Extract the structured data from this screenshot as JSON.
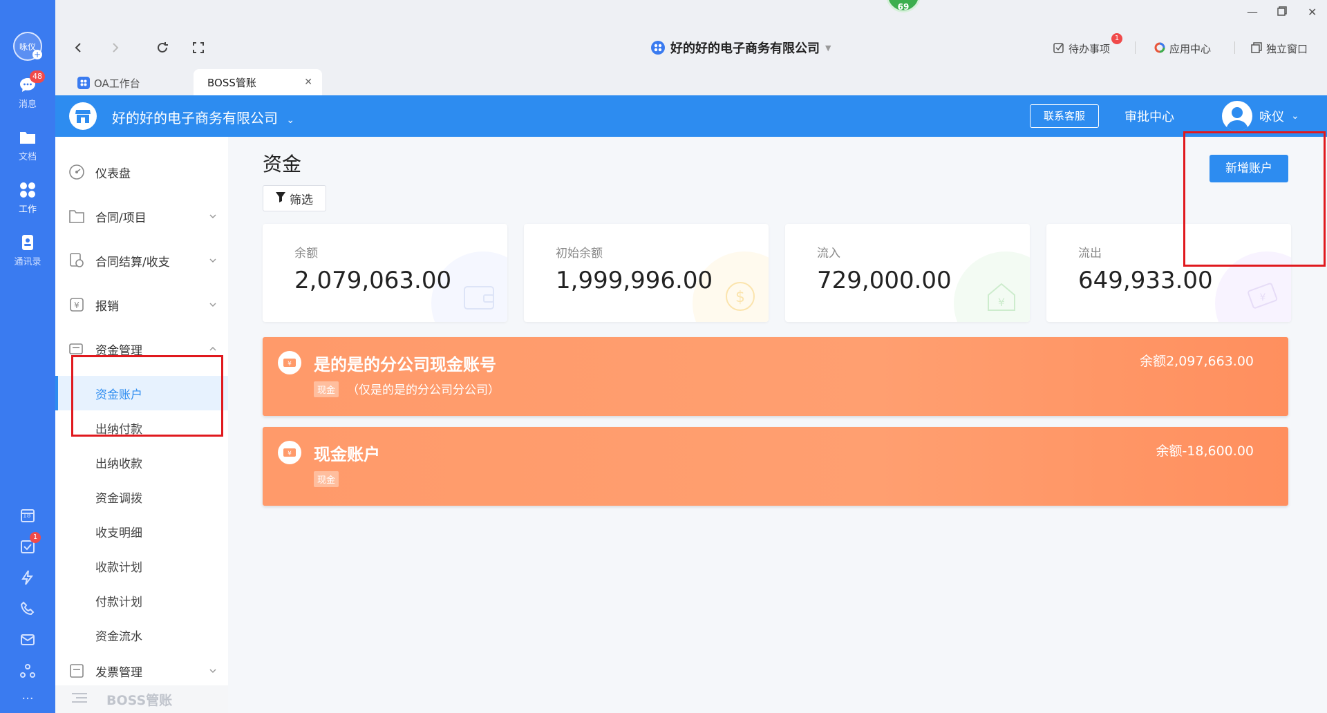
{
  "rail": {
    "avatar_text": "咏仪",
    "items": [
      {
        "label": "消息",
        "badge": "48"
      },
      {
        "label": "文档"
      },
      {
        "label": "工作"
      },
      {
        "label": "通讯录"
      }
    ],
    "calendar_day": "18",
    "tasks_badge": "1"
  },
  "topbar": {
    "company": "好的好的电子商务有限公司",
    "online_count": "69",
    "todo_label": "待办事项",
    "todo_badge": "1",
    "app_center_label": "应用中心",
    "standalone_label": "独立窗口"
  },
  "tabs": [
    {
      "label": "OA工作台"
    },
    {
      "label": "BOSS管账"
    }
  ],
  "header": {
    "company": "好的好的电子商务有限公司",
    "contact_btn": "联系客服",
    "approve_label": "审批中心",
    "user_name": "咏仪"
  },
  "menu": {
    "items": [
      {
        "label": "仪表盘"
      },
      {
        "label": "合同/项目"
      },
      {
        "label": "合同结算/收支"
      },
      {
        "label": "报销"
      },
      {
        "label": "资金管理"
      }
    ],
    "sub_items": [
      {
        "label": "资金账户"
      },
      {
        "label": "出纳付款"
      },
      {
        "label": "出纳收款"
      },
      {
        "label": "资金调拨"
      },
      {
        "label": "收支明细"
      },
      {
        "label": "收款计划"
      },
      {
        "label": "付款计划"
      },
      {
        "label": "资金流水"
      }
    ],
    "invoice_label": "发票管理",
    "footer_label": "BOSS管账"
  },
  "page": {
    "title": "资金",
    "filter_label": "筛选",
    "add_button": "新增账户"
  },
  "stats": [
    {
      "label": "余额",
      "value": "2,079,063.00"
    },
    {
      "label": "初始余额",
      "value": "1,999,996.00"
    },
    {
      "label": "流入",
      "value": "729,000.00"
    },
    {
      "label": "流出",
      "value": "649,933.00"
    }
  ],
  "accounts": [
    {
      "name": "是的是的分公司现金账号",
      "tag": "现金",
      "desc": "（仅是的是的分公司分公司）",
      "balance": "余额2,097,663.00"
    },
    {
      "name": "现金账户",
      "tag": "现金",
      "desc": "",
      "balance": "余额-18,600.00"
    }
  ],
  "colors": {
    "rail": "#3a7bf0",
    "header": "#2d8cf0",
    "account_card": "#ff9a6a",
    "highlight_box": "#e0191e"
  }
}
